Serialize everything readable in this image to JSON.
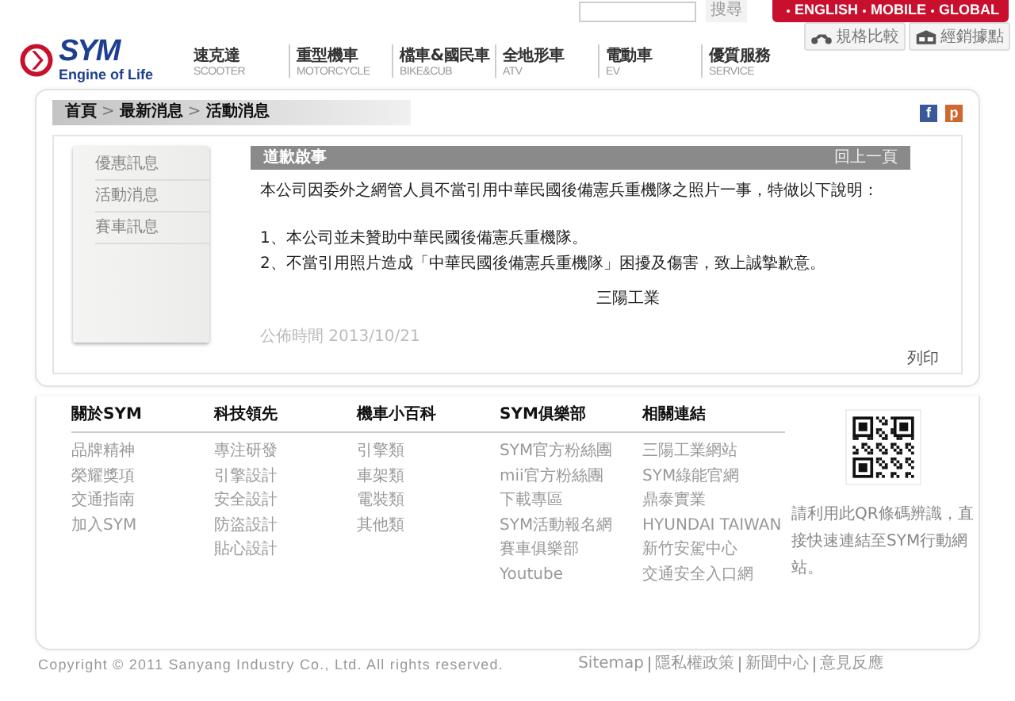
{
  "header": {
    "logo": {
      "name": "SYM",
      "tagline": "Engine of Life"
    },
    "search": {
      "button": "搜尋"
    },
    "language_links": [
      "ENGLISH",
      "MOBILE",
      "GLOBAL"
    ],
    "nav": [
      {
        "label": "速克達",
        "sub": "SCOOTER"
      },
      {
        "label": "重型機車",
        "sub": "MOTORCYCLE"
      },
      {
        "label": "檔車&國民車",
        "sub": "BIKE&CUB"
      },
      {
        "label": "全地形車",
        "sub": "ATV"
      },
      {
        "label": "電動車",
        "sub": "EV"
      },
      {
        "label": "優質服務",
        "sub": "SERVICE"
      }
    ],
    "tools": [
      {
        "label": "規格比較",
        "kind": "compare"
      },
      {
        "label": "經銷據點",
        "kind": "dealer"
      }
    ]
  },
  "breadcrumb": {
    "items": [
      "首頁",
      "最新消息",
      "活動消息"
    ],
    "separator": ">"
  },
  "share": [
    {
      "kind": "facebook",
      "glyph": "f"
    },
    {
      "kind": "plurk",
      "glyph": "p"
    }
  ],
  "sidebar": [
    "優惠訊息",
    "活動消息",
    "賽車訊息"
  ],
  "article": {
    "title": "道歉啟事",
    "back": "回上一頁",
    "intro": "本公司因委外之網管人員不當引用中華民國後備憲兵重機隊之照片一事，特做以下說明：",
    "points": [
      "1、本公司並未贊助中華民國後備憲兵重機隊。",
      "2、不當引用照片造成「中華民國後備憲兵重機隊」困擾及傷害，致上誠摯歉意。"
    ],
    "signature": "三陽工業",
    "published": "公佈時間 2013/10/21",
    "print": "列印"
  },
  "footer": {
    "columns": [
      {
        "heading": "關於SYM",
        "links": [
          "品牌精神",
          "榮耀獎項",
          "交通指南",
          "加入SYM"
        ]
      },
      {
        "heading": "科技領先",
        "links": [
          "專注研發",
          "引擎設計",
          "安全設計",
          "防盜設計",
          "貼心設計"
        ]
      },
      {
        "heading": "機車小百科",
        "links": [
          "引擎類",
          "車架類",
          "電裝類",
          "其他類"
        ]
      },
      {
        "heading": "SYM俱樂部",
        "links": [
          "SYM官方粉絲團",
          "mii官方粉絲團",
          "下載專區",
          "SYM活動報名網",
          "賽車俱樂部",
          "Youtube"
        ]
      },
      {
        "heading": "相關連結",
        "links": [
          "三陽工業網站",
          "SYM綠能官網",
          "鼎泰實業",
          "HYUNDAI TAIWAN",
          "新竹安駕中心",
          "交通安全入口網"
        ]
      }
    ],
    "qr_caption": "請利用此QR條碼辨識，直接快速連結至SYM行動網站。",
    "copyright": "Copyright © 2011 Sanyang Industry Co., Ltd. All rights reserved.",
    "links": [
      "Sitemap",
      "隱私權政策",
      "新聞中心",
      "意見反應"
    ]
  }
}
